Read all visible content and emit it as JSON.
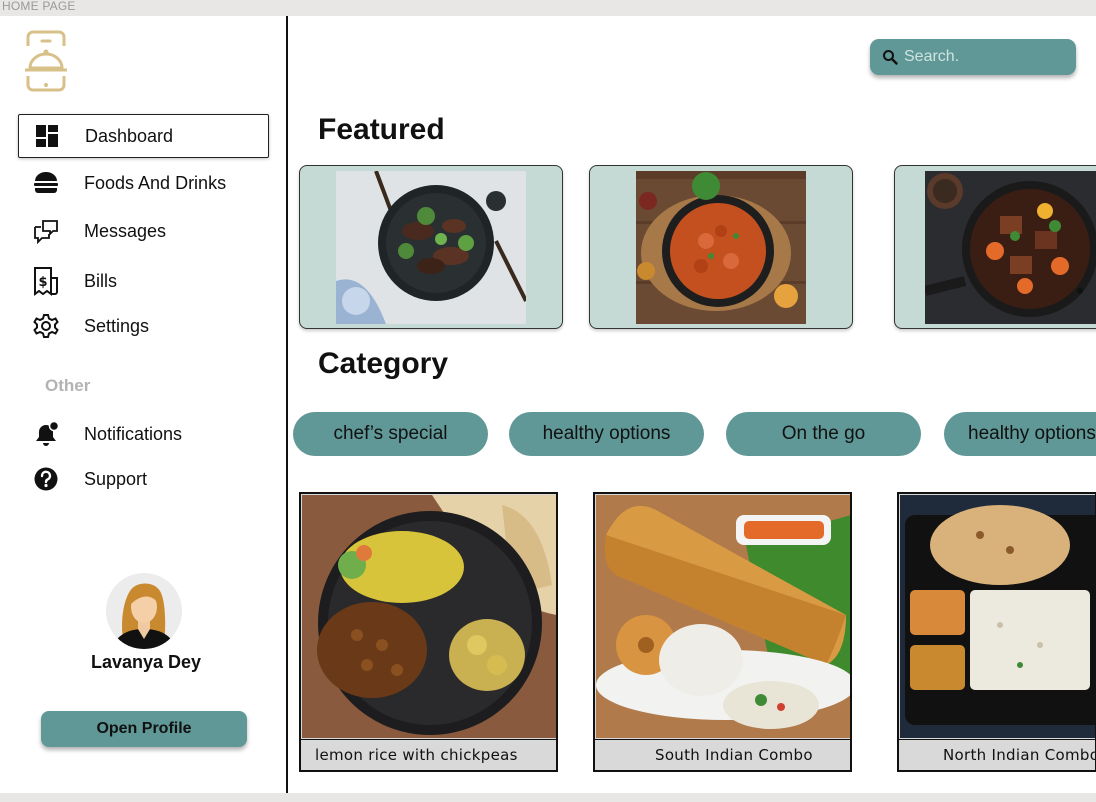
{
  "frame_label": "HOME PAGE",
  "sidebar": {
    "items": [
      {
        "label": "Dashboard",
        "icon": "dashboard-icon",
        "active": true
      },
      {
        "label": "Foods And Drinks",
        "icon": "burger-icon"
      },
      {
        "label": "Messages",
        "icon": "messages-icon"
      },
      {
        "label": "Bills",
        "icon": "bill-icon"
      },
      {
        "label": "Settings",
        "icon": "gear-icon"
      }
    ],
    "other_label": "Other",
    "other_items": [
      {
        "label": "Notifications",
        "icon": "bell-icon"
      },
      {
        "label": "Support",
        "icon": "question-icon"
      }
    ],
    "user": {
      "name": "Lavanya Dey"
    },
    "open_profile_label": "Open Profile"
  },
  "search": {
    "placeholder": "Search."
  },
  "featured": {
    "heading": "Featured"
  },
  "category": {
    "heading": "Category",
    "pills": [
      "chef’s special",
      "healthy options",
      "On the go",
      "healthy options"
    ]
  },
  "dishes": [
    {
      "name": "lemon rice with chickpeas"
    },
    {
      "name": "South Indian Combo"
    },
    {
      "name": "North Indian Combo"
    }
  ],
  "colors": {
    "accent": "#5f9896",
    "card_bg": "#c5dad5",
    "logo": "#d8c089"
  }
}
